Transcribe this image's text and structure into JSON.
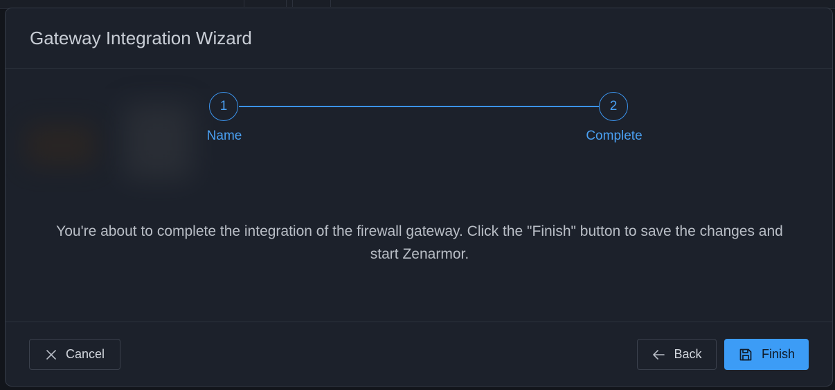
{
  "dialog": {
    "title": "Gateway Integration Wizard"
  },
  "stepper": {
    "steps": [
      {
        "number": "1",
        "label": "Name"
      },
      {
        "number": "2",
        "label": "Complete"
      }
    ],
    "accent_color": "#3b93ec"
  },
  "body": {
    "message": "You're about to complete the integration of the firewall gateway. Click the \"Finish\" button to save the changes and start Zenarmor."
  },
  "footer": {
    "cancel_label": "Cancel",
    "cancel_icon": "close-icon",
    "back_label": "Back",
    "back_icon": "arrow-left-icon",
    "finish_label": "Finish",
    "finish_icon": "save-icon",
    "primary_color": "#3c9cf6"
  }
}
